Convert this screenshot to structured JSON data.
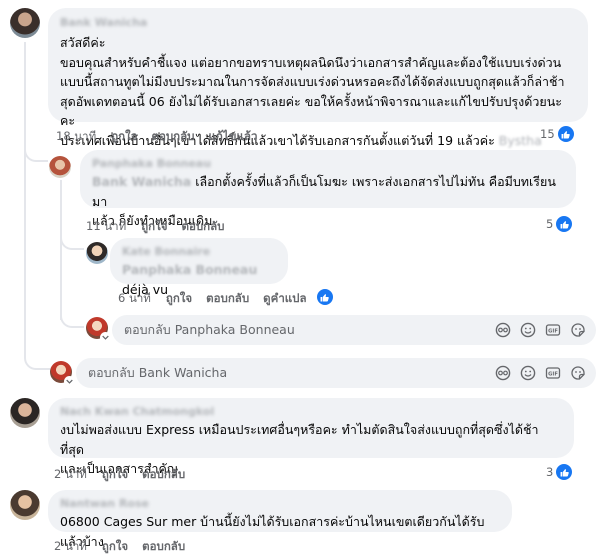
{
  "comments": [
    {
      "author": "Bank Wanicha",
      "lines": [
        "สวัสดีค่ะ",
        "ขอบคุณสำหรับคำชี้แจง แต่อยากขอทราบเหตุผลนิดนึงว่าเอกสารสำคัญและต้องใช้แบบเร่งด่วน",
        "แบบนี้สถานทูตไม่มีงบประมาณในการจัดส่งแบบเร่งด่วนหรอคะถึงได้จัดส่งแบบถูกสุดแล้วก็ล่าช้า",
        "สุดอัพเดทตอนนี้ 06 ยังไม่ได้รับเอกสารเลยค่ะ ขอให้ครั้งหน้าพิจารณาและแก้ไขปรับปรุงด้วยนะคะ",
        "ประเทศเพื่อนบ้านอื่นๆเขาได้สิทธิ์กันแล้วเขาได้รับเอกสารกันตั้งแต่วันที่ 19 แล้วค่ะ"
      ],
      "tag": "Bystha",
      "time": "18 นาที",
      "like": "ถูกใจ",
      "reply": "ตอบกลับ",
      "edited": "แก้ไขแล้ว",
      "reaction_count": "15"
    },
    {
      "author": "Panphaka Bonneau",
      "mention": "Bank Wanicha",
      "lines": [
        "เลือกตั้งครั้งที่แล้วก็เป็นโมฆะ เพราะส่งเอกสารไปไม่ทัน คือมีบทเรียนมา",
        "แล้ว ก็ยังทำเหมือนเดิม"
      ],
      "time": "11 นาที",
      "like": "ถูกใจ",
      "reply": "ตอบกลับ",
      "reaction_count": "5"
    },
    {
      "author": "Kate Bonnaire",
      "mention": "Panphaka Bonneau",
      "text": "déjà vu",
      "time": "6 นาที",
      "like": "ถูกใจ",
      "reply": "ตอบกลับ",
      "translate": "ดูคำแปล"
    },
    {
      "author": "Nach Kwan Chatmongkol",
      "lines": [
        "งบไม่พอส่งแบบ Express เหมือนประเทศอื่นๆหรือคะ ทำไมตัดสินใจส่งแบบถูกที่สุดซึ่งได้ช้าที่สุด",
        "และเป็นเอกสารสำคัญ"
      ],
      "time": "2 นาที",
      "like": "ถูกใจ",
      "reply": "ตอบกลับ",
      "reaction_count": "3"
    },
    {
      "author": "Nantwan Rose",
      "text": "06800 Cages Sur mer บ้านนี้ยังไม่ได้รับเอกสารค่ะบ้านไหนเขตเดียวกันได้รับแล้วบ้าง",
      "time": "2 นาที",
      "like": "ถูกใจ",
      "reply": "ตอบกลับ"
    }
  ],
  "reply_boxes": [
    {
      "placeholder": "ตอบกลับ Panphaka Bonneau"
    },
    {
      "placeholder": "ตอบกลับ Bank Wanicha"
    }
  ],
  "icons": [
    "thumbs-up-icon",
    "avatar-sticker-icon",
    "emoji-icon",
    "gif-icon",
    "sticker-icon"
  ],
  "colors": {
    "like_blue": "#1877f2",
    "bubble_bg": "#f0f2f5",
    "meta_gray": "#65676b"
  }
}
